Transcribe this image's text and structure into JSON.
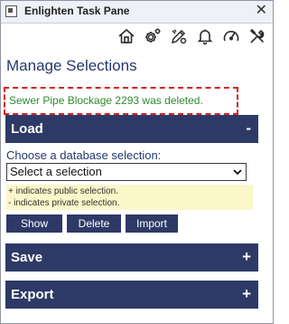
{
  "window": {
    "title": "Enlighten Task Pane",
    "close_glyph": "✕"
  },
  "toolbar": {
    "icons": [
      "home-icon",
      "settings-cog-icon",
      "edit-tools-icon",
      "bell-icon",
      "gauge-icon",
      "tools-icon"
    ]
  },
  "page": {
    "title": "Manage Selections",
    "status_message": "Sewer Pipe Blockage 2293 was deleted."
  },
  "sections": {
    "load": {
      "title": "Load",
      "toggle": "-",
      "choose_label": "Choose a database selection:",
      "select_value": "Select a selection",
      "legend_public": "+ indicates public selection.",
      "legend_private": "- indicates private selection.",
      "buttons": {
        "show": "Show",
        "delete": "Delete",
        "import": "Import"
      }
    },
    "save": {
      "title": "Save",
      "toggle": "+"
    },
    "export": {
      "title": "Export",
      "toggle": "+"
    }
  },
  "colors": {
    "header_bg": "#2d3a66",
    "status_green": "#2f8a2f",
    "highlight_red": "#d62020",
    "legend_bg": "#fbf7c9"
  }
}
